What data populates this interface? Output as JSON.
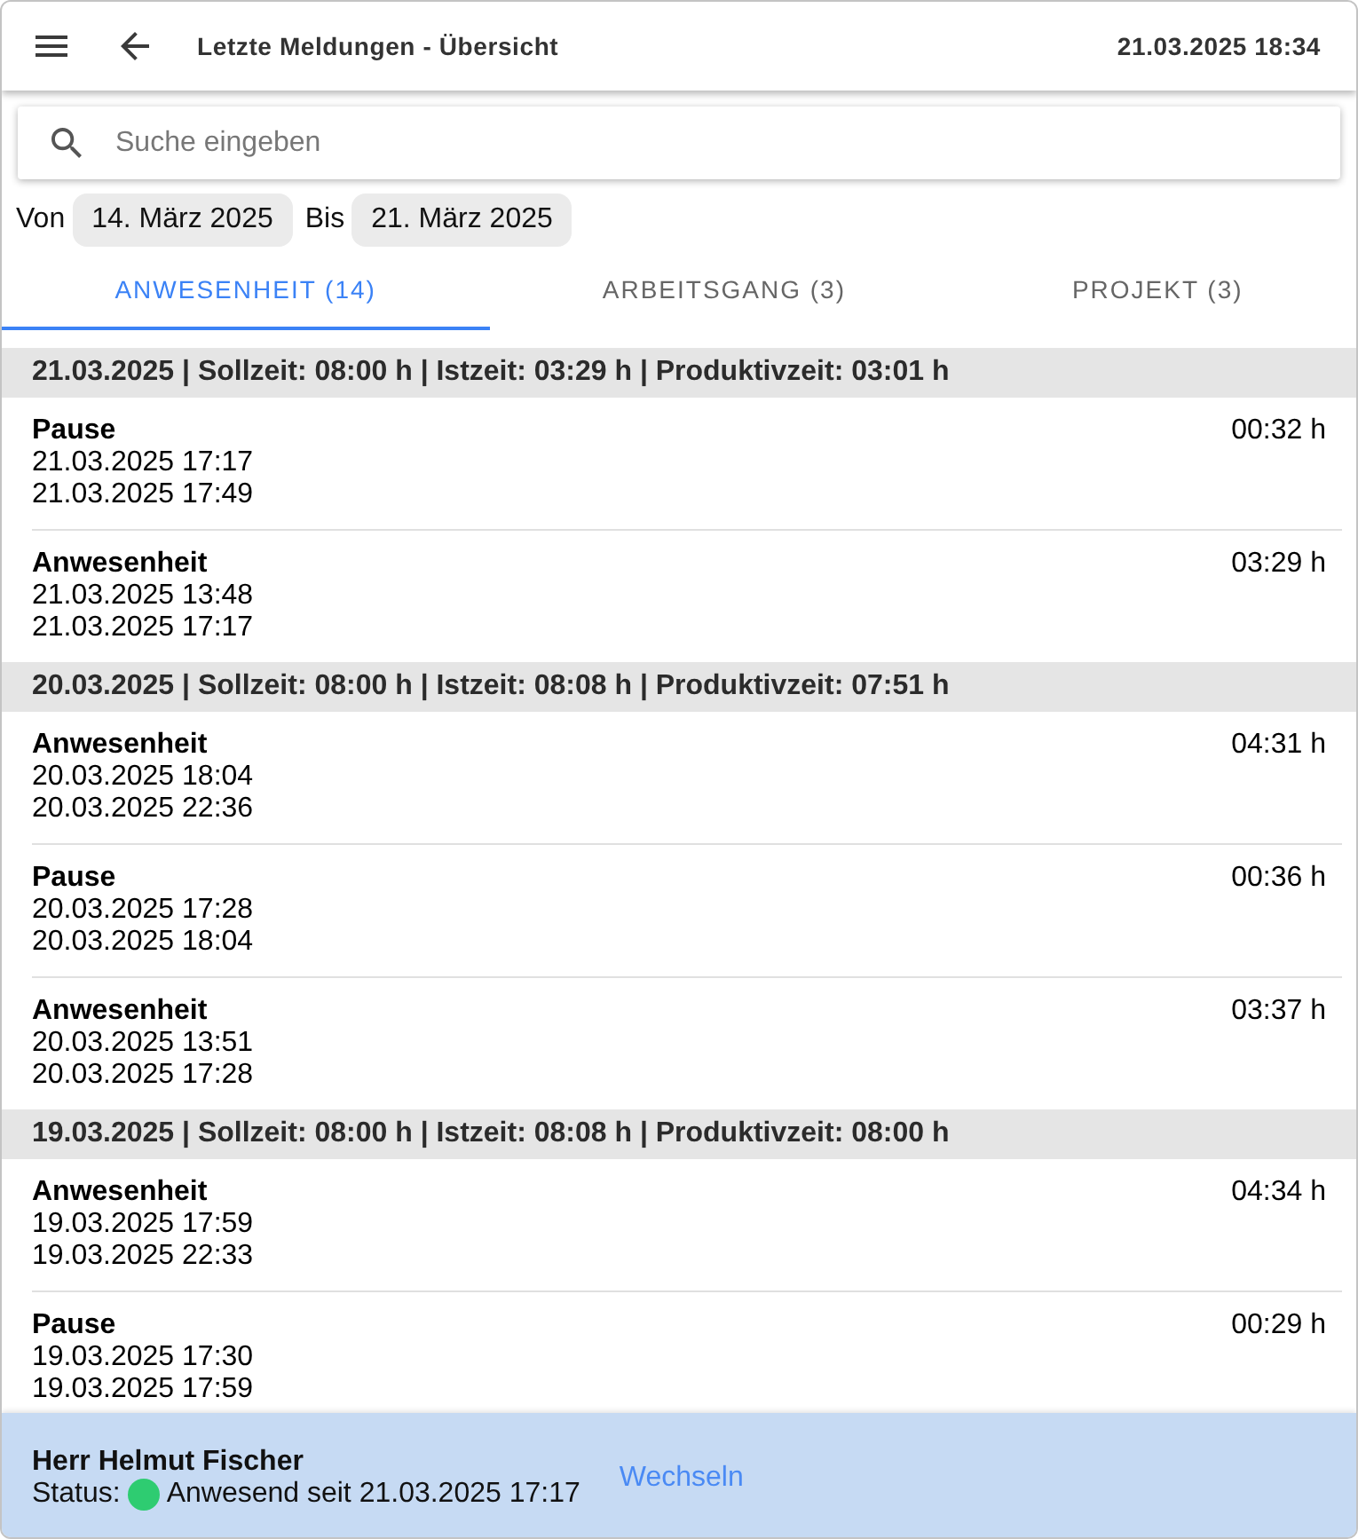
{
  "header": {
    "title": "Letzte Meldungen - Übersicht",
    "datetime": "21.03.2025 18:34"
  },
  "search": {
    "placeholder": "Suche eingeben"
  },
  "date_range": {
    "from_label": "Von",
    "from": "14. März 2025",
    "to_label": "Bis",
    "to": "21. März 2025"
  },
  "tabs": [
    {
      "label": "ANWESENHEIT (14)",
      "selected": true
    },
    {
      "label": "ARBEITSGANG (3)",
      "selected": false
    },
    {
      "label": "PROJEKT (3)",
      "selected": false
    }
  ],
  "groups": [
    {
      "header": "21.03.2025 | Sollzeit: 08:00 h | Istzeit: 03:29 h | Produktivzeit: 03:01 h",
      "entries": [
        {
          "title": "Pause",
          "start": "21.03.2025 17:17",
          "end": "21.03.2025 17:49",
          "duration": "00:32 h"
        },
        {
          "title": "Anwesenheit",
          "start": "21.03.2025 13:48",
          "end": "21.03.2025 17:17",
          "duration": "03:29 h"
        }
      ]
    },
    {
      "header": "20.03.2025 | Sollzeit: 08:00 h | Istzeit: 08:08 h | Produktivzeit: 07:51 h",
      "entries": [
        {
          "title": "Anwesenheit",
          "start": "20.03.2025 18:04",
          "end": "20.03.2025 22:36",
          "duration": "04:31 h"
        },
        {
          "title": "Pause",
          "start": "20.03.2025 17:28",
          "end": "20.03.2025 18:04",
          "duration": "00:36 h"
        },
        {
          "title": "Anwesenheit",
          "start": "20.03.2025 13:51",
          "end": "20.03.2025 17:28",
          "duration": "03:37 h"
        }
      ]
    },
    {
      "header": "19.03.2025 | Sollzeit: 08:00 h | Istzeit: 08:08 h | Produktivzeit: 08:00 h",
      "entries": [
        {
          "title": "Anwesenheit",
          "start": "19.03.2025 17:59",
          "end": "19.03.2025 22:33",
          "duration": "04:34 h"
        },
        {
          "title": "Pause",
          "start": "19.03.2025 17:30",
          "end": "19.03.2025 17:59",
          "duration": "00:29 h"
        }
      ]
    }
  ],
  "footer": {
    "name": "Herr Helmut Fischer",
    "status": {
      "label": "Status:",
      "color": "#2ecc71",
      "text": "Anwesend seit 21.03.2025 17:17"
    },
    "action": "Wechseln"
  }
}
